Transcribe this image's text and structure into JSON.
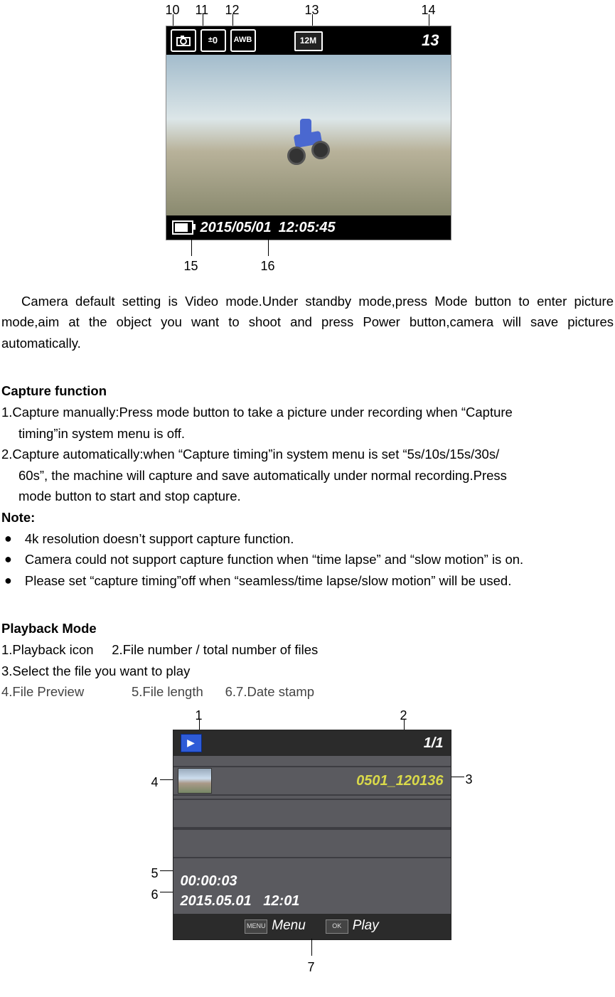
{
  "figure1": {
    "callouts": {
      "c10": "10",
      "c11": "11",
      "c12": "12",
      "c13": "13",
      "c14": "14",
      "c15": "15",
      "c16": "16"
    },
    "topbar": {
      "ev_label": "0",
      "awb_label": "AWB",
      "resolution_label": "12M",
      "count": "13"
    },
    "bottombar": {
      "date": "2015/05/01",
      "time": "12:05:45"
    }
  },
  "intro_para": "Camera default setting is Video mode.Under standby mode,press Mode button to enter picture mode,aim at the object you want to shoot and press Power button,camera will save pictures automatically.",
  "capture": {
    "title": "Capture function",
    "item1_l1": "1.Capture manually:Press mode button to take a picture under recording when “Capture",
    "item1_l2": "timing”in system menu is off.",
    "item2_l1": "2.Capture automatically:when “Capture timing”in system menu is set “5s/10s/15s/30s/",
    "item2_l2": "60s”, the machine will capture and save automatically under normal recording.Press",
    "item2_l3": "mode button to start and stop capture.",
    "note_label": "Note:",
    "bullet1": "4k resolution doesn’t support capture function.",
    "bullet2": "Camera could not support capture function when “time lapse” and “slow motion” is on.",
    "bullet3": "Please set “capture timing”off when “seamless/time lapse/slow motion” will be used."
  },
  "playback": {
    "title": "Playback Mode",
    "legend_line1": "1.Playback icon     2.File number / total number of files",
    "legend_line2": "3.Select the file you want to play",
    "legend_line3": "4.File Preview             5.File length      6.7.Date stamp"
  },
  "figure2": {
    "callouts": {
      "c1": "1",
      "c2": "2",
      "c3": "3",
      "c4": "4",
      "c5": "5",
      "c6": "6",
      "c7": "7"
    },
    "topbar": {
      "count": "1/1"
    },
    "filename": "0501_120136",
    "length": "00:00:03",
    "date": "2015.05.01",
    "time": "12:01",
    "bottombar": {
      "menu_icon": "MENU",
      "menu_label": "Menu",
      "ok_icon": "OK",
      "play_label": "Play"
    }
  }
}
